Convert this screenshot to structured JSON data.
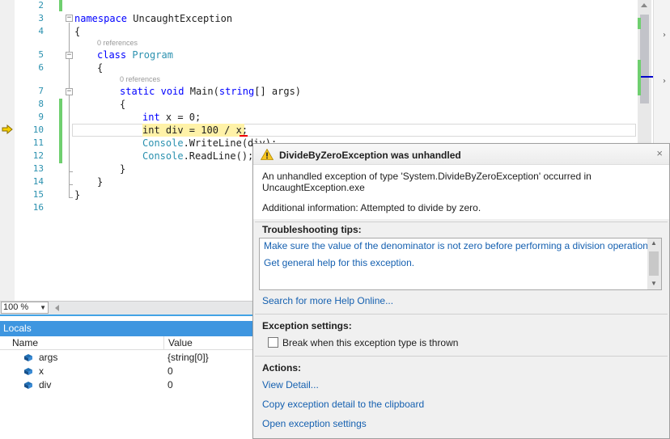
{
  "editor": {
    "line_numbers": [
      "2",
      "3",
      "4",
      "5",
      "6",
      "7",
      "8",
      "9",
      "10",
      "11",
      "12",
      "13",
      "14",
      "15",
      "16"
    ],
    "lines": {
      "l3_kw": "namespace",
      "l3_rest": " UncaughtException",
      "l4": "{",
      "l5_kw": "class",
      "l5_ty": "Program",
      "l6": "{",
      "l7_kw1": "static",
      "l7_kw2": "void",
      "l7_mid": " Main(",
      "l7_kw3": "string",
      "l7_end": "[] args)",
      "l8": "{",
      "l9_kw": "int",
      "l9_rest": " x = 0;",
      "l10_kw": "int",
      "l10_rest": " div = 100 / x;",
      "l11_ty": "Console",
      "l11_rest": ".WriteLine(div);",
      "l12_ty": "Console",
      "l12_rest": ".ReadLine();",
      "l13": "}",
      "l14": "}",
      "l15": "}"
    },
    "ref_hint_class": "0 references",
    "ref_hint_main": "0 references",
    "outline_minus": "−"
  },
  "zoom": {
    "value": "100 %"
  },
  "locals": {
    "title": "Locals",
    "columns": {
      "name": "Name",
      "value": "Value"
    },
    "rows": [
      {
        "name": "args",
        "value": "{string[0]}"
      },
      {
        "name": "x",
        "value": "0"
      },
      {
        "name": "div",
        "value": "0"
      }
    ]
  },
  "exception": {
    "title": "DivideByZeroException was unhandled",
    "close_glyph": "×",
    "description": "An unhandled exception of type 'System.DivideByZeroException' occurred in UncaughtException.exe",
    "additional_info": "Additional information: Attempted to divide by zero.",
    "tips_heading": "Troubleshooting tips:",
    "tips": [
      "Make sure the value of the denominator is not zero before performing a division operation.",
      "Get general help for this exception."
    ],
    "search_link": "Search for more Help Online...",
    "settings_heading": "Exception settings:",
    "break_label": "Break when this exception type is thrown",
    "actions_heading": "Actions:",
    "actions": [
      "View Detail...",
      "Copy exception detail to the clipboard",
      "Open exception settings"
    ]
  },
  "colors": {
    "keyword": "#0000ff",
    "type": "#2b91af",
    "link": "#1560b0",
    "locals_title_bg": "#3e96e0",
    "statement_highlight": "#fff2a8"
  }
}
